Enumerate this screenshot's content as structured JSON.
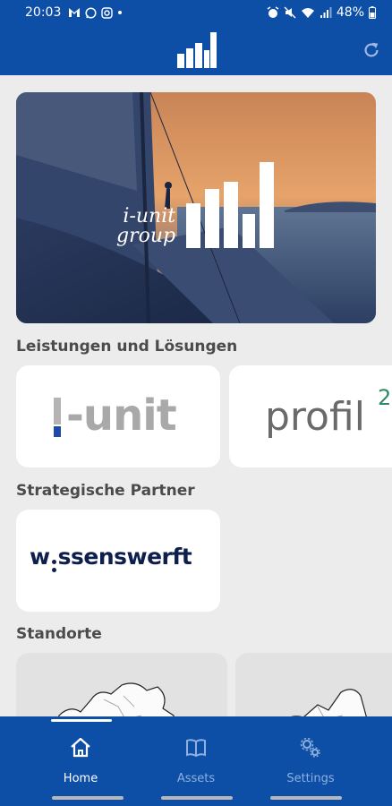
{
  "status": {
    "time": "20:03",
    "battery": "48%"
  },
  "appbar": {
    "logo_icon": "bar-chart-logo",
    "refresh_icon": "refresh-icon"
  },
  "hero": {
    "brand_line1": "i-unit",
    "brand_line2": "group"
  },
  "sections": {
    "services_title": "Leistungen und Lösungen",
    "partners_title": "Strategische Partner",
    "locations_title": "Standorte"
  },
  "services": [
    {
      "name": "i-unit",
      "prefix": "",
      "suffix": "-unit"
    },
    {
      "name": "profil",
      "sup": "2"
    }
  ],
  "partners": [
    {
      "pre": "w",
      "post": "ssenswerft"
    }
  ],
  "nav": {
    "items": [
      {
        "label": "Home",
        "icon": "home-icon",
        "active": true
      },
      {
        "label": "Assets",
        "icon": "book-icon",
        "active": false
      },
      {
        "label": "Settings",
        "icon": "settings-icon",
        "active": false
      }
    ]
  },
  "colors": {
    "primary": "#0d4ea6",
    "background": "#ececec",
    "inactive_nav": "#8fb0de"
  }
}
